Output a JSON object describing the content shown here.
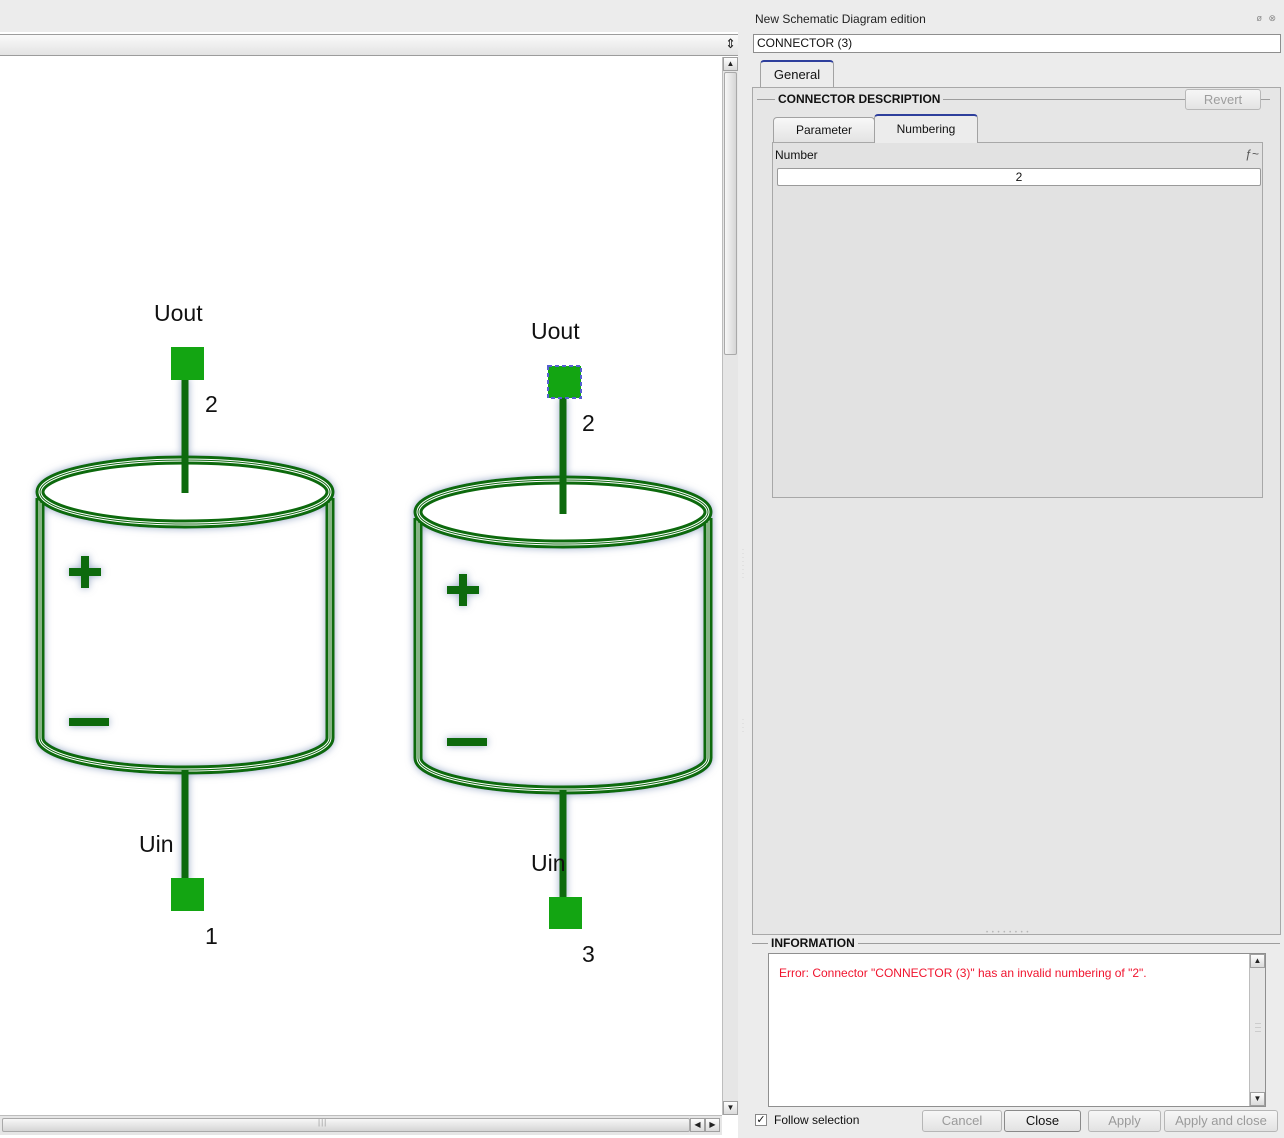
{
  "canvas": {
    "left_component": {
      "top_label": "Uout",
      "top_number": "2",
      "bottom_label": "Uin",
      "bottom_number": "1",
      "plus": "+",
      "minus": "−"
    },
    "right_component": {
      "top_label": "Uout",
      "top_number": "2",
      "bottom_label": "Uin",
      "bottom_number": "3",
      "plus": "+",
      "minus": "−"
    },
    "colors": {
      "stroke": "#0c6a10",
      "connector": "#13a512",
      "selection": "#5560d0",
      "glow": "#8fa0bf"
    }
  },
  "panel": {
    "title": "New Schematic Diagram edition",
    "float_controls": "ø ⊗",
    "element_name": "CONNECTOR (3)",
    "tabs": [
      {
        "label": "General",
        "active": true
      }
    ],
    "description_group": {
      "title": "CONNECTOR DESCRIPTION",
      "revert_label": "Revert",
      "sub_tabs": [
        {
          "label": "Parameter",
          "active": false
        },
        {
          "label": "Numbering",
          "active": true
        }
      ],
      "number_label": "Number",
      "formula_icon": "ƒ~",
      "number_value": "2"
    },
    "information": {
      "title": "INFORMATION",
      "message": "Error: Connector \"CONNECTOR (3)\" has an invalid numbering of \"2\"."
    },
    "follow_selection_label": "Follow selection",
    "follow_selection_checked": true,
    "buttons": {
      "cancel": "Cancel",
      "close": "Close",
      "apply": "Apply",
      "apply_and_close": "Apply and close"
    }
  }
}
